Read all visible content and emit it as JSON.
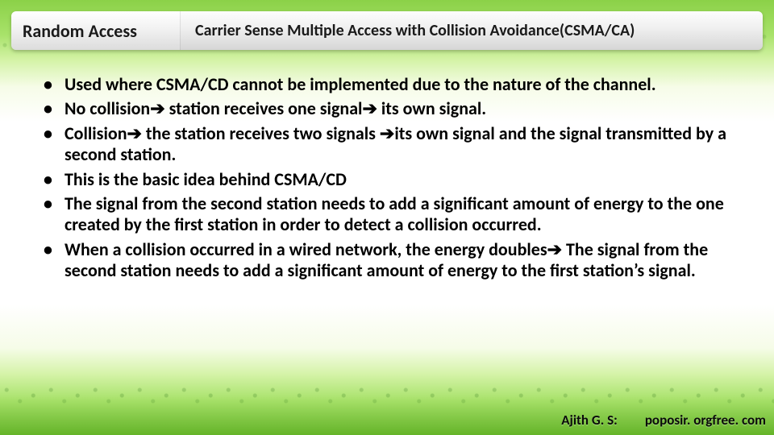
{
  "header": {
    "left": "Random Access",
    "right": "Carrier Sense Multiple Access  with  Collision Avoidance(CSMA/CA)"
  },
  "bullets": [
    "Used where CSMA/CD cannot be implemented due to the nature of the channel.",
    "No collision➔ station receives one signal➔ its own signal.",
    "Collision➔ the station receives two signals ➔its own signal and the signal transmitted by a second station.",
    "This is the basic idea behind CSMA/CD",
    "The signal from the second station needs to add a significant amount of energy to the one created by the first station in order to detect a collision occurred.",
    " When a collision occurred in a wired network, the energy doubles➔ The signal from the second station needs to add a significant amount of energy to the first station’s signal."
  ],
  "footer": {
    "author": "Ajith G. S:",
    "site": "poposir. orgfree. com"
  }
}
